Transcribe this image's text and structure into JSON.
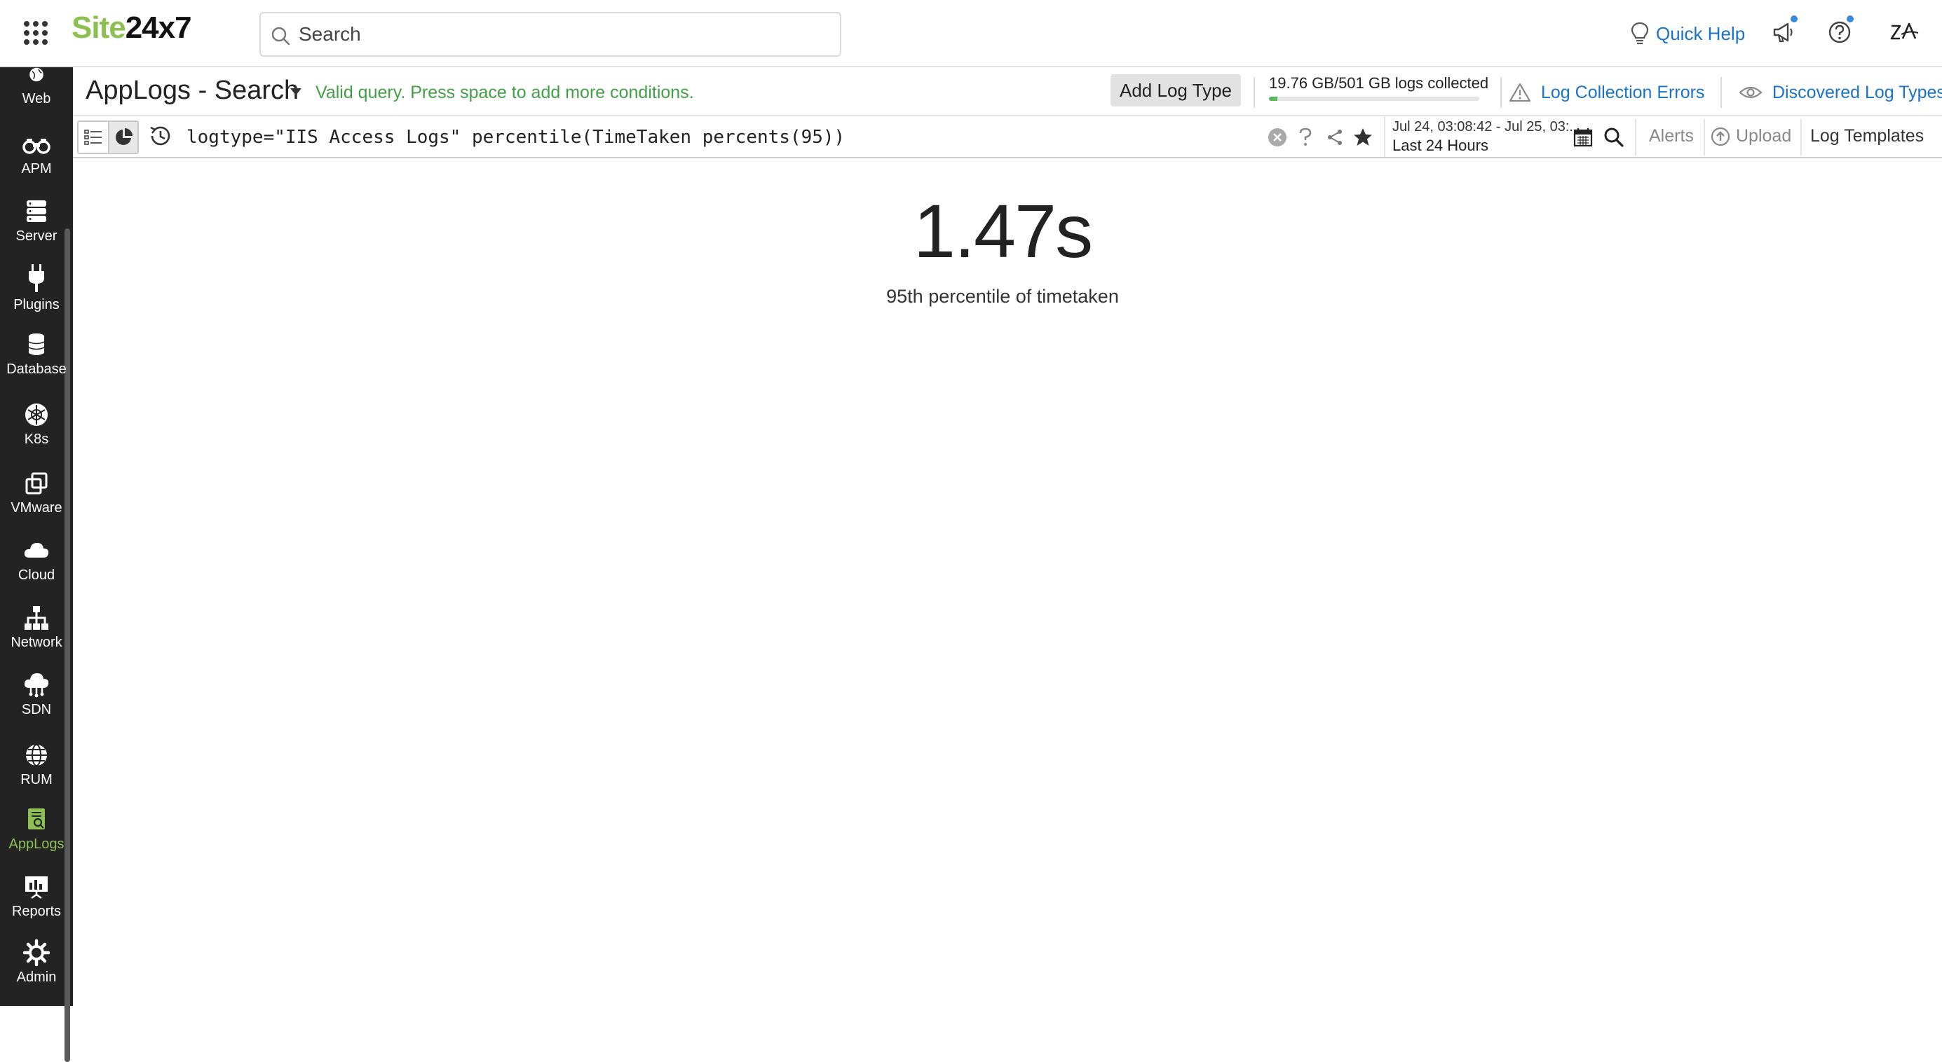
{
  "app": {
    "logo_part1": "Site",
    "logo_part2": "24x7",
    "search_placeholder": "Search",
    "quick_help": "Quick Help",
    "accent_color": "#8cc152",
    "link_color": "#1a73c9",
    "icons": [
      "apps-grid-icon",
      "search-icon",
      "lightbulb-icon",
      "megaphone-icon",
      "help-icon",
      "zia-icon"
    ]
  },
  "sidebar": {
    "items": [
      {
        "label": "Web",
        "icon": "globe-icon"
      },
      {
        "label": "APM",
        "icon": "binoculars-icon"
      },
      {
        "label": "Server",
        "icon": "server-icon"
      },
      {
        "label": "Plugins",
        "icon": "plug-icon"
      },
      {
        "label": "Database",
        "icon": "database-icon"
      },
      {
        "label": "K8s",
        "icon": "kubernetes-icon"
      },
      {
        "label": "VMware",
        "icon": "vmware-icon"
      },
      {
        "label": "Cloud",
        "icon": "cloud-icon"
      },
      {
        "label": "Network",
        "icon": "network-icon"
      },
      {
        "label": "SDN",
        "icon": "sdn-cloud-icon"
      },
      {
        "label": "RUM",
        "icon": "rum-globe-icon"
      },
      {
        "label": "AppLogs",
        "icon": "applogs-icon",
        "active": true
      },
      {
        "label": "Reports",
        "icon": "reports-icon"
      },
      {
        "label": "Admin",
        "icon": "gear-icon"
      }
    ]
  },
  "header": {
    "title": "AppLogs - Search",
    "valid_message": "Valid query. Press space to add more conditions.",
    "add_log_type": "Add Log Type",
    "usage_text": "19.76 GB/501 GB logs collected",
    "usage_fraction": 0.039,
    "log_collection_errors": "Log Collection Errors",
    "discovered_log_types": "Discovered Log Types"
  },
  "query": {
    "text": "logtype=\"IIS Access Logs\" percentile(TimeTaken percents(95))",
    "date_range": "Jul 24, 03:08:42 - Jul 25, 03:...",
    "range_label": "Last 24 Hours",
    "alerts": "Alerts",
    "upload": "Upload",
    "log_templates": "Log Templates"
  },
  "result": {
    "value": "1.47s",
    "caption": "95th percentile of timetaken"
  }
}
